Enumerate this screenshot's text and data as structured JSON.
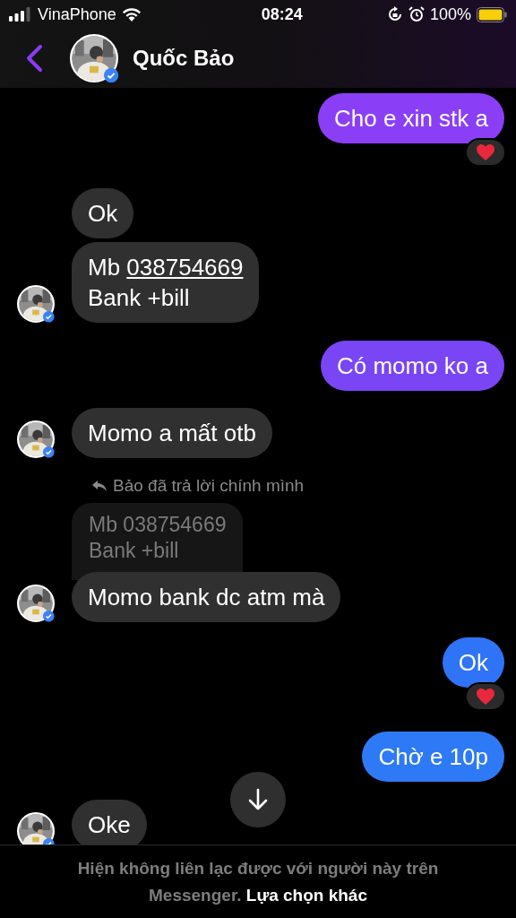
{
  "status_bar": {
    "carrier": "VinaPhone",
    "time": "08:24",
    "battery": "100%"
  },
  "header": {
    "name": "Quốc Bảo",
    "verified": true
  },
  "messages": [
    {
      "outgoing": true,
      "color": "#8a3ff6",
      "lines": [
        {
          "text": "Cho e xin stk a"
        }
      ],
      "reacted": true
    },
    {
      "outgoing": false,
      "lines": [
        {
          "text": "Ok"
        }
      ],
      "reacted": false
    },
    {
      "outgoing": false,
      "lines": [
        {
          "text": "Mb ",
          "link": "038754669"
        },
        {
          "text": "Bank +bill"
        }
      ],
      "reacted": false
    },
    {
      "outgoing": true,
      "color": "#7945f5",
      "lines": [
        {
          "text": "Có momo ko a"
        }
      ],
      "reacted": false
    },
    {
      "outgoing": false,
      "lines": [
        {
          "text": "Momo a mất otb"
        }
      ],
      "reacted": false
    },
    {
      "outgoing": false,
      "reply": {
        "label": "Bảo đã trả lời chính mình",
        "quoted_lines": [
          "Mb 038754669",
          "Bank +bill"
        ]
      },
      "lines": [
        {
          "text": "Momo bank dc atm mà"
        }
      ],
      "reacted": false
    },
    {
      "outgoing": true,
      "color": "#2f74f6",
      "lines": [
        {
          "text": "Ok"
        }
      ],
      "reacted": true
    },
    {
      "outgoing": true,
      "color": "#2e7af6",
      "lines": [
        {
          "text": "Chờ e 10p"
        }
      ],
      "reacted": false
    },
    {
      "outgoing": false,
      "lines": [
        {
          "text": "Oke"
        }
      ],
      "reacted": false
    }
  ],
  "footer": {
    "notice": "Hiện không liên lạc được với người này trên Messenger.",
    "link": "Lựa chọn khác"
  }
}
